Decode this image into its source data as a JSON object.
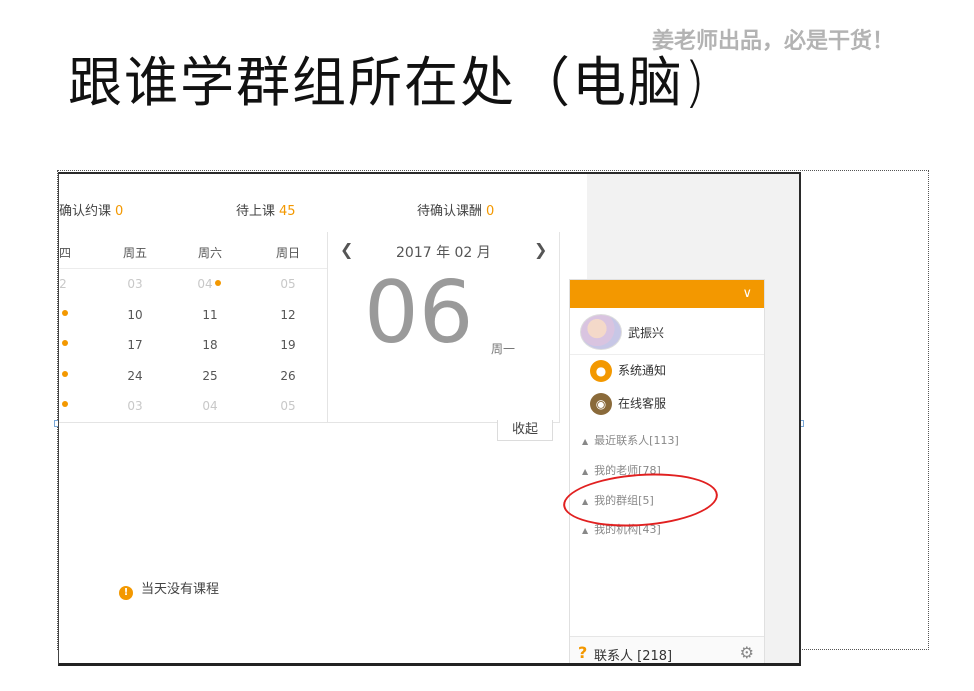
{
  "slide": {
    "title": "跟谁学群组所在处（电脑)",
    "tag": "姜老师出品，必是干货！"
  },
  "stats": [
    {
      "label": "确认约课",
      "value": "0"
    },
    {
      "label": "待上课",
      "value": "45"
    },
    {
      "label": "待确认课酬",
      "value": "0"
    }
  ],
  "calendar": {
    "weekdays": [
      "四",
      "周五",
      "周六",
      "周日"
    ],
    "month_label": "2017 年 02 月",
    "prev_icon": "chevron-left-icon",
    "next_icon": "chevron-right-icon",
    "rows": [
      [
        "2",
        "03",
        "04",
        "05"
      ],
      [
        "",
        "10",
        "11",
        "12"
      ],
      [
        "",
        "17",
        "18",
        "19"
      ],
      [
        "",
        "24",
        "25",
        "26"
      ],
      [
        "",
        "03",
        "04",
        "05"
      ]
    ],
    "big_day": "06",
    "weekday_label": "周一",
    "collapse_label": "收起",
    "no_course_text": "当天没有课程"
  },
  "contacts": {
    "header_icon": "chevron-down-icon",
    "me_name": "武振兴",
    "system_items": [
      {
        "label": "系统通知",
        "icon": "notification-icon"
      },
      {
        "label": "在线客服",
        "icon": "customer-service-icon"
      }
    ],
    "groups": [
      {
        "label": "最近联系人[113]"
      },
      {
        "label": "我的老师[78]"
      },
      {
        "label": "我的群组[5]"
      },
      {
        "label": "我的机构[43]"
      }
    ],
    "footer_q": "?",
    "footer_label": "联系人 [218]",
    "footer_icon": "gear-icon"
  },
  "colors": {
    "accent": "#f39800",
    "highlight": "#e12020"
  }
}
